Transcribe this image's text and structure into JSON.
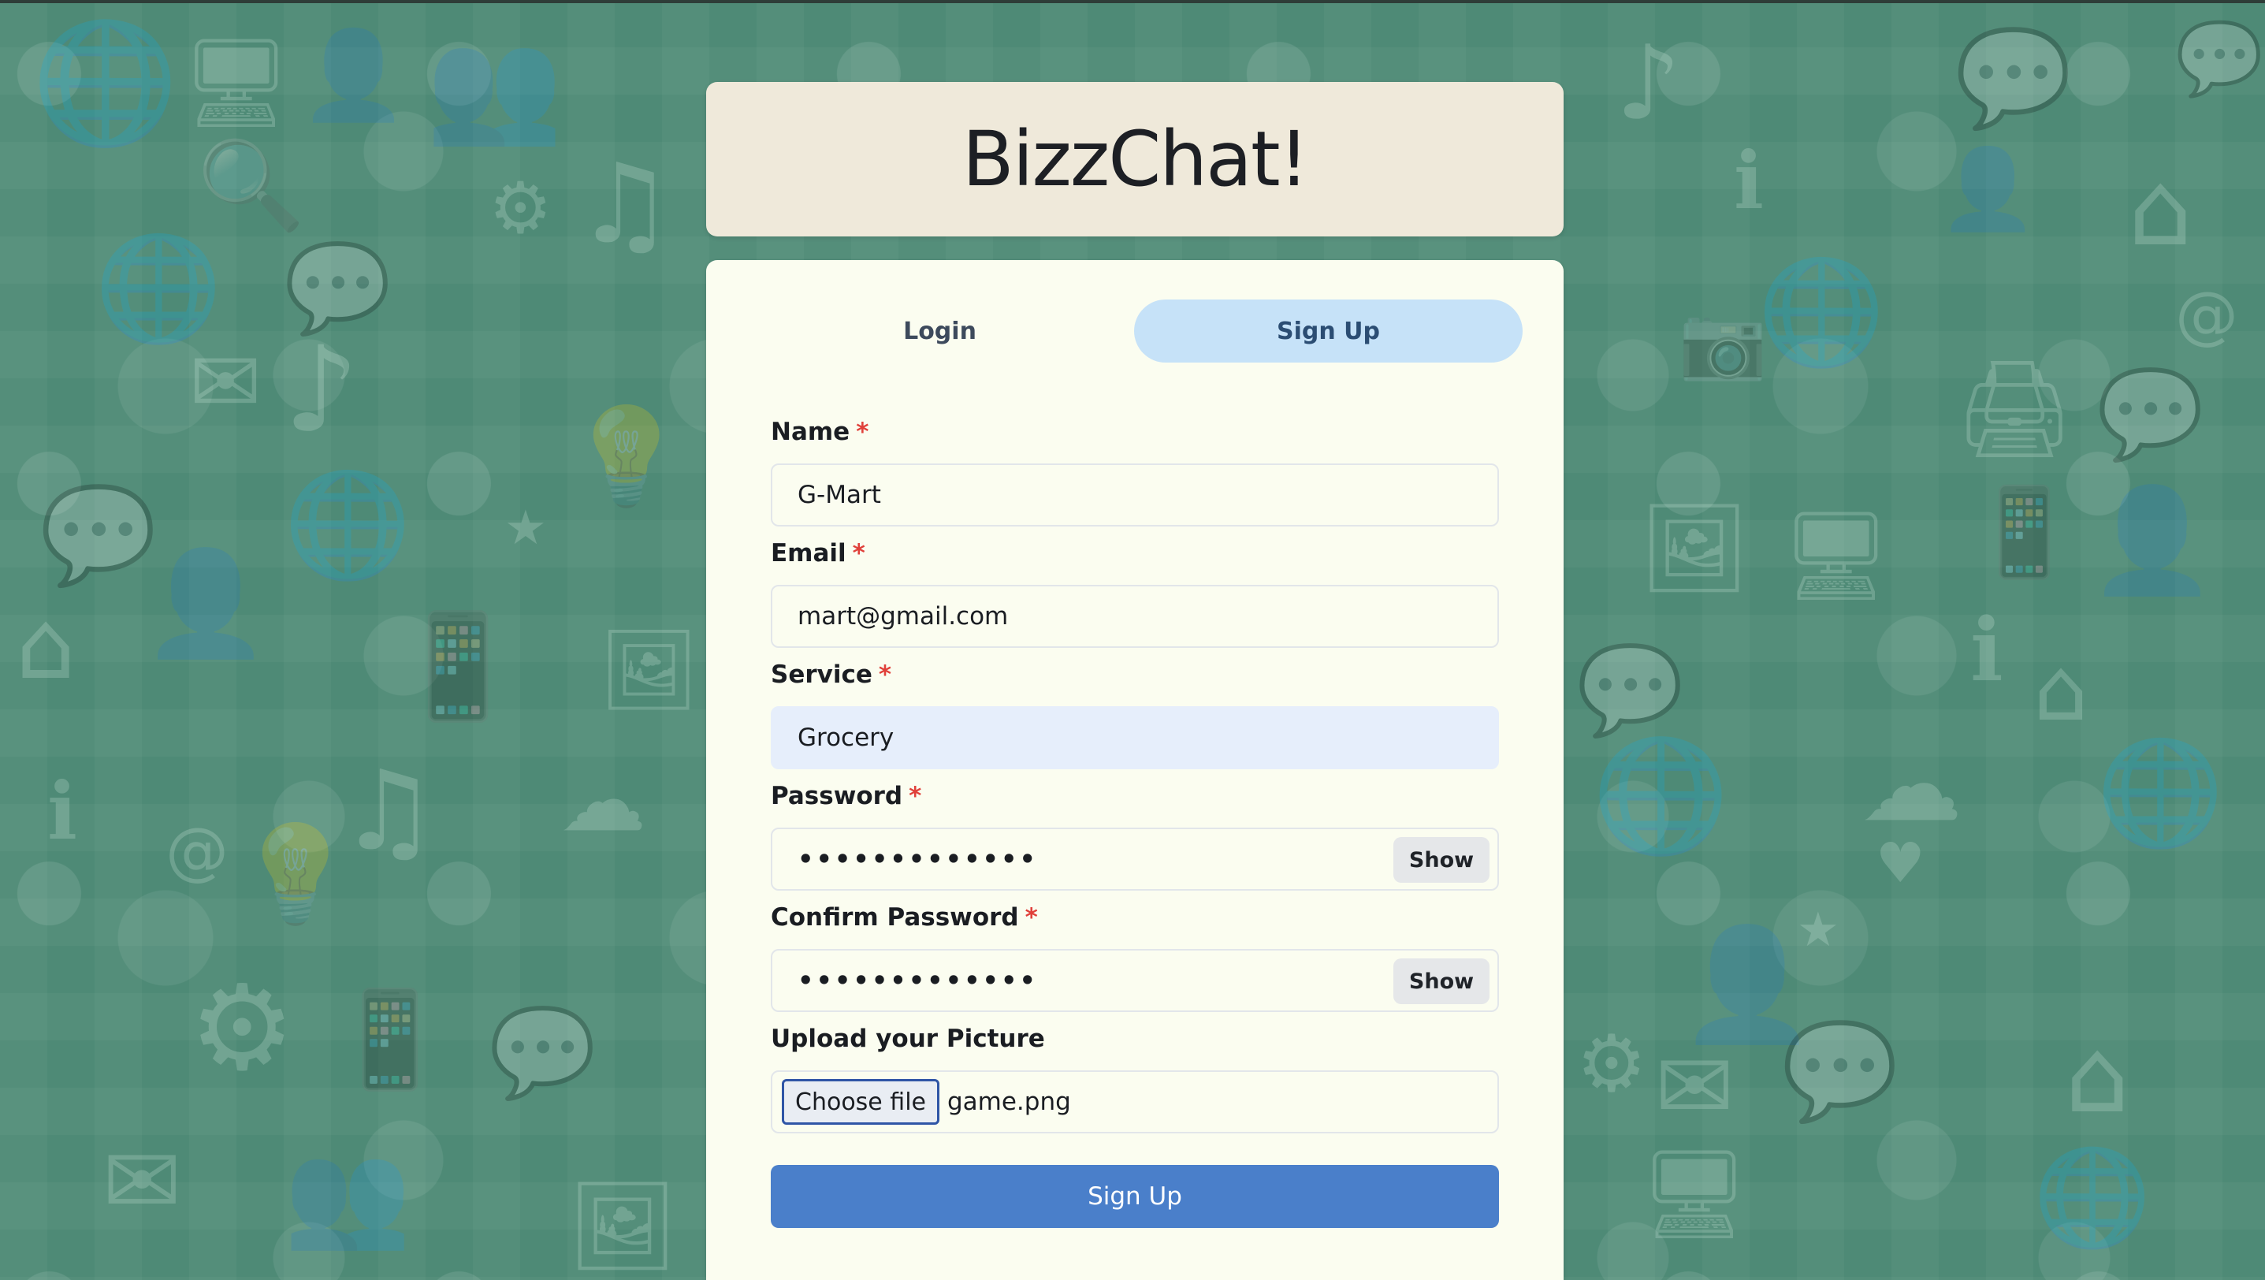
{
  "app": {
    "title": "BizzChat!"
  },
  "tabs": [
    {
      "label": "Login",
      "active": false
    },
    {
      "label": "Sign Up",
      "active": true
    }
  ],
  "form": {
    "name": {
      "label": "Name",
      "required_mark": "*",
      "value": "G-Mart"
    },
    "email": {
      "label": "Email",
      "required_mark": "*",
      "value": "mart@gmail.com"
    },
    "service": {
      "label": "Service",
      "required_mark": "*",
      "value": "Grocery"
    },
    "password": {
      "label": "Password",
      "required_mark": "*",
      "value_masked": "•••••••••••••",
      "show_label": "Show"
    },
    "confirm_password": {
      "label": "Confirm Password",
      "required_mark": "*",
      "value_masked": "•••••••••••••",
      "show_label": "Show"
    },
    "picture": {
      "label": "Upload your Picture",
      "button_label": "Choose file",
      "file_name": "game.png"
    },
    "submit_label": "Sign Up"
  },
  "colors": {
    "background": "#4e8a76",
    "header_card": "#efe9da",
    "form_card": "#fbfdf0",
    "active_tab": "#c6e2f8",
    "submit_button": "#4a7fca",
    "required_mark": "#e0403a",
    "autofill_field": "#e6eefb"
  },
  "background_icons": [
    "globe-icon",
    "chat-bubble-icon",
    "mail-icon",
    "camera-icon",
    "music-note-icon",
    "gear-icon",
    "lightbulb-icon",
    "person-icon",
    "house-icon",
    "star-icon",
    "heart-icon",
    "phone-icon",
    "cloud-icon",
    "magnifier-icon",
    "info-icon",
    "at-sign-icon"
  ]
}
